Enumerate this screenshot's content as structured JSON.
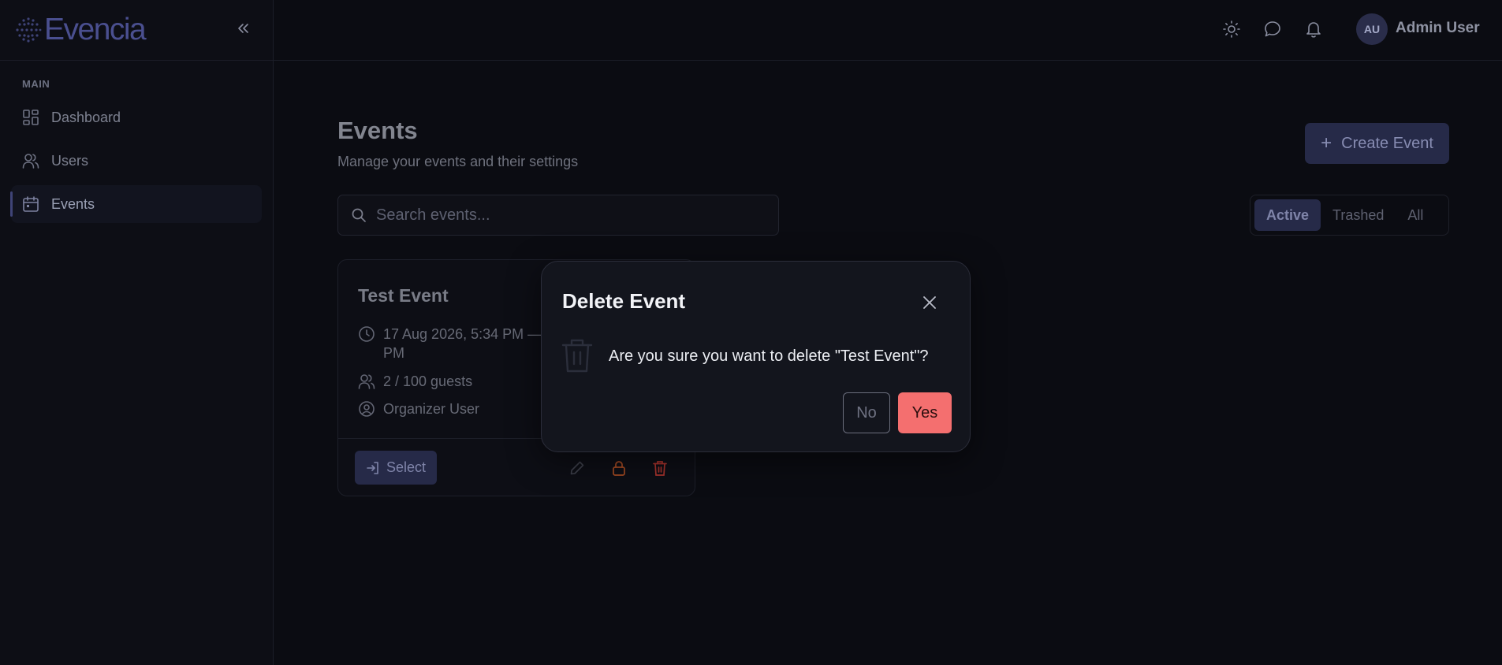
{
  "brand": {
    "name": "Evencia"
  },
  "sidebar": {
    "section_label": "MAIN",
    "items": [
      {
        "label": "Dashboard",
        "icon": "dashboard-icon"
      },
      {
        "label": "Users",
        "icon": "users-icon"
      },
      {
        "label": "Events",
        "icon": "calendar-icon",
        "active": true
      }
    ]
  },
  "topbar": {
    "user_initials": "AU",
    "user_name": "Admin User",
    "icons": [
      "sun-icon",
      "chat-icon",
      "bell-icon"
    ]
  },
  "main": {
    "title": "Events",
    "subtitle": "Manage your events and their settings",
    "create_label": "Create Event",
    "search_placeholder": "Search events...",
    "filters": [
      {
        "label": "Active",
        "active": true
      },
      {
        "label": "Trashed"
      },
      {
        "label": "All"
      }
    ]
  },
  "event_card": {
    "title": "Test Event",
    "date_line1": "17 Aug 2026, 5:34 PM —",
    "date_line2": "PM",
    "guests": "2 / 100 guests",
    "organizer": "Organizer User",
    "select_label": "Select"
  },
  "modal": {
    "title": "Delete Event",
    "message": "Are you sure you want to delete \"Test Event\"?",
    "no_label": "No",
    "yes_label": "Yes"
  },
  "colors": {
    "accent": "#262a48",
    "danger": "#f46f6f",
    "warning": "#c65a2a",
    "background": "#0b0c12"
  }
}
